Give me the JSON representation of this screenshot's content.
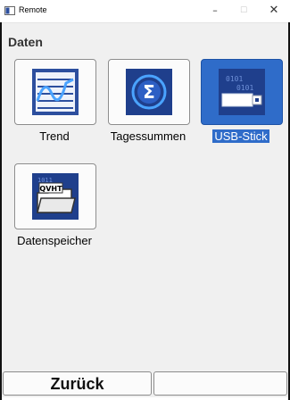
{
  "window": {
    "title": "Remote",
    "min_glyph": "–",
    "max_glyph": "☐",
    "close_glyph": "✕"
  },
  "page": {
    "heading": "Daten"
  },
  "tiles": [
    {
      "label": "Trend",
      "icon": "trend-chart-icon",
      "selected": false
    },
    {
      "label": "Tagessummen",
      "icon": "sigma-sum-icon",
      "selected": false
    },
    {
      "label": "USB-Stick",
      "icon": "usb-stick-icon",
      "selected": true
    },
    {
      "label": "Datenspeicher",
      "icon": "data-folder-icon",
      "selected": false,
      "icon_text": "QVHT"
    }
  ],
  "buttons": {
    "back": "Zurück",
    "right": ""
  },
  "colors": {
    "selection": "#2f6cc9",
    "background": "#f0f0f0",
    "icon_blue": "#2d4f9e"
  }
}
